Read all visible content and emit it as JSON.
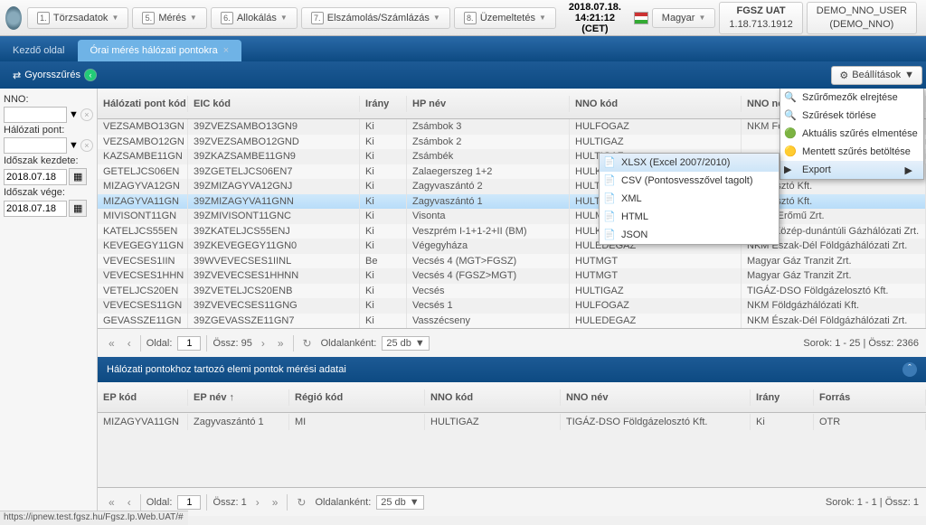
{
  "top": {
    "menus": [
      {
        "n": "1.",
        "label": "Törzsadatok"
      },
      {
        "n": "5.",
        "label": "Mérés"
      },
      {
        "n": "6.",
        "label": "Allokálás"
      },
      {
        "n": "7.",
        "label": "Elszámolás/Számlázás"
      },
      {
        "n": "8.",
        "label": "Üzemeltetés"
      }
    ],
    "date": "2018.07.18.",
    "time": "14:21:12 (CET)",
    "lang": "Magyar",
    "env1": "FGSZ UAT",
    "env2": "1.18.713.1912",
    "user1": "DEMO_NNO_USER",
    "user2": "(DEMO_NNO)"
  },
  "tabs": [
    {
      "label": "Kezdő oldal"
    },
    {
      "label": "Órai mérés hálózati pontokra",
      "active": true
    }
  ],
  "quick": "Gyorsszűrés",
  "filters": {
    "nno": "NNO:",
    "halozati": "Hálózati pont:",
    "kezdete": "Időszak kezdete:",
    "kezdete_v": "2018.07.18",
    "vege": "Időszak vége:",
    "vege_v": "2018.07.18"
  },
  "settings": "Beállítások",
  "grid": {
    "headers": [
      "Hálózati pont kód",
      "EIC kód",
      "Irány",
      "HP név",
      "NNO kód",
      "NNO név"
    ],
    "rows": [
      [
        "VEZSAMBO13GN",
        "39ZVEZSAMBO13GN9",
        "Ki",
        "Zsámbok 3",
        "HULFOGAZ",
        "NKM Földgázháló"
      ],
      [
        "VEZSAMBO12GN",
        "39ZVEZSAMBO12GND",
        "Ki",
        "Zsámbok 2",
        "HULTIGAZ",
        ""
      ],
      [
        "KAZSAMBE11GN",
        "39ZKAZSAMBE11GN9",
        "Ki",
        "Zsámbék",
        "HULTIGAZ",
        ""
      ],
      [
        "GETELJCS06EN",
        "39ZGETELJCS06EN7",
        "Ki",
        "Zalaegerszeg 1+2",
        "HULKOGAZ",
        "túli Gázhálózati Zrt."
      ],
      [
        "MIZAGYVA12GN",
        "39ZMIZAGYVA12GNJ",
        "Ki",
        "Zagyvaszántó 2",
        "HULTIGAZ",
        "gázelosztó Kft."
      ],
      [
        "MIZAGYVA11GN",
        "39ZMIZAGYVA11GNN",
        "Ki",
        "Zagyvaszántó 1",
        "HULTIGAZ",
        "gázelosztó Kft."
      ],
      [
        "MIVISONT11GN",
        "39ZMIVISONT11GNC",
        "Ki",
        "Visonta",
        "HULMERT",
        "Mátrai Erőmű Zrt."
      ],
      [
        "KATELJCS55EN",
        "39ZKATELJCS55ENJ",
        "Ki",
        "Veszprém I-1+1-2+II (BM)",
        "HULKOGAZ",
        "E.ON Közép-dunántúli Gázhálózati Zrt."
      ],
      [
        "KEVEGEGY11GN",
        "39ZKEVEGEGY11GN0",
        "Ki",
        "Végegyháza",
        "HULEDEGAZ",
        "NKM Észak-Dél Földgázhálózati Zrt."
      ],
      [
        "VEVECSES1IIN",
        "39WVEVECSES1IINL",
        "Be",
        "Vecsés 4 (MGT>FGSZ)",
        "HUTMGT",
        "Magyar Gáz Tranzit Zrt."
      ],
      [
        "VEVECSES1HHN",
        "39ZVEVECSES1HHNN",
        "Ki",
        "Vecsés 4 (FGSZ>MGT)",
        "HUTMGT",
        "Magyar Gáz Tranzit Zrt."
      ],
      [
        "VETELJCS20EN",
        "39ZVETELJCS20ENB",
        "Ki",
        "Vecsés",
        "HULTIGAZ",
        "TIGÁZ-DSO Földgázelosztó Kft."
      ],
      [
        "VEVECSES11GN",
        "39ZVEVECSES11GNG",
        "Ki",
        "Vecsés 1",
        "HULFOGAZ",
        "NKM Földgázhálózati Kft."
      ],
      [
        "GEVASSZE11GN",
        "39ZGEVASSZE11GN7",
        "Ki",
        "Vasszécseny",
        "HULEDEGAZ",
        "NKM Észak-Dél Földgázhálózati Zrt."
      ]
    ],
    "selected": 5
  },
  "pager": {
    "pageLbl": "Oldal:",
    "page": "1",
    "totalLbl": "Össz: 95",
    "perPageLbl": "Oldalanként:",
    "perPage": "25 db",
    "summary": "Sorok: 1 - 25 | Össz: 2366"
  },
  "detail": {
    "title": "Hálózati pontokhoz tartozó elemi pontok mérési adatai",
    "headers": [
      "EP kód",
      "EP név ↑",
      "Régió kód",
      "NNO kód",
      "NNO név",
      "Irány",
      "Forrás"
    ],
    "row": [
      "MIZAGYVA11GN",
      "Zagyvaszántó 1",
      "MI",
      "HULTIGAZ",
      "TIGÁZ-DSO Földgázelosztó Kft.",
      "Ki",
      "OTR"
    ],
    "summary": "Sorok: 1 - 1 | Össz: 1"
  },
  "settingsMenu": [
    "Szűrőmezők elrejtése",
    "Szűrések törlése",
    "Aktuális szűrés elmentése",
    "Mentett szűrés betöltése",
    "Export"
  ],
  "exportMenu": [
    "XLSX (Excel 2007/2010)",
    "CSV (Pontosvesszővel tagolt)",
    "XML",
    "HTML",
    "JSON"
  ],
  "status": "https://ipnew.test.fgsz.hu/Fgsz.Ip.Web.UAT/#"
}
